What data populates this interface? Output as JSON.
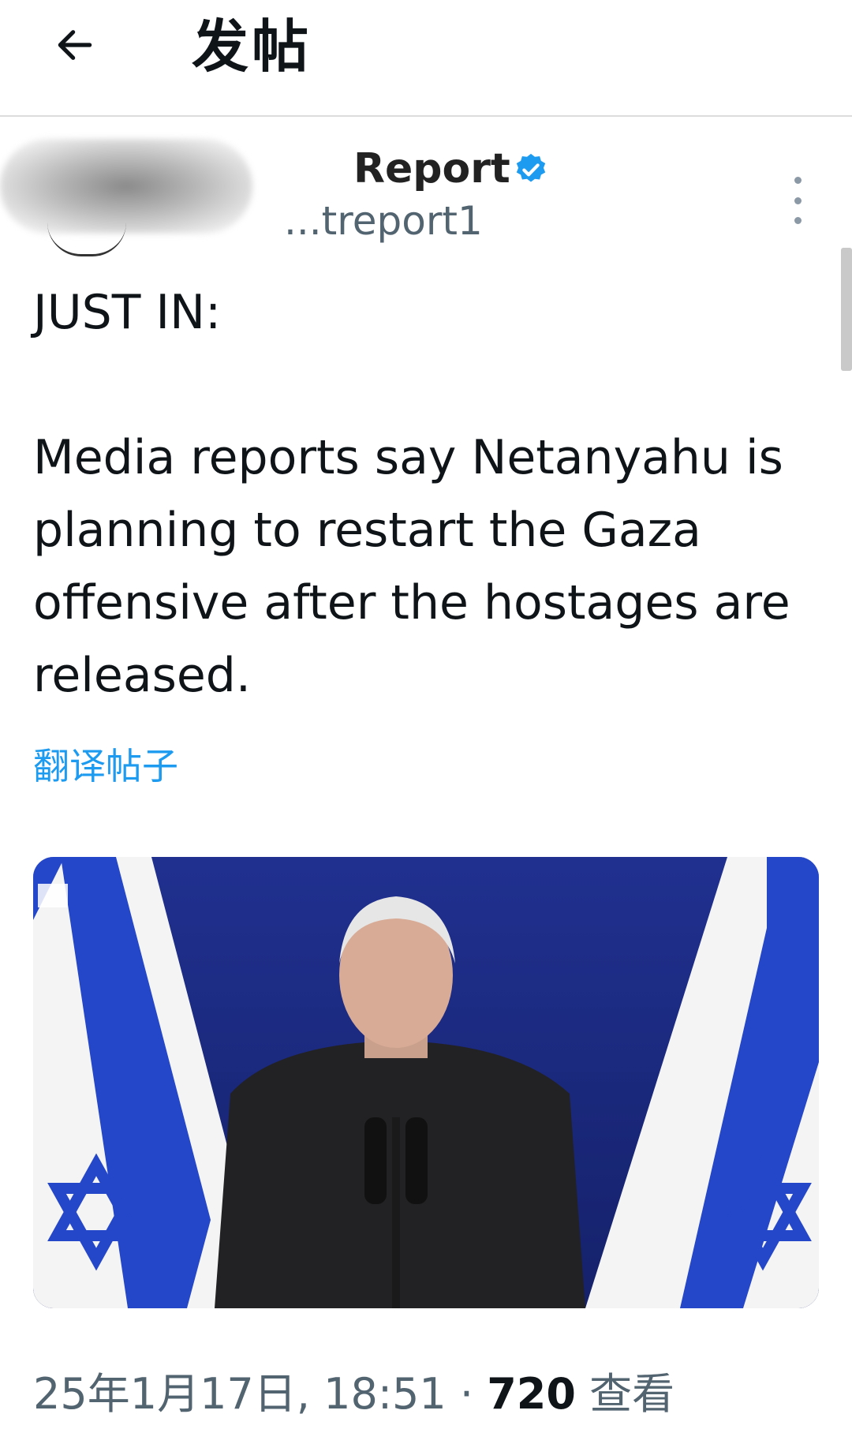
{
  "header": {
    "title": "发帖",
    "back_icon": "arrow-left-icon"
  },
  "author": {
    "display_name": "Report",
    "handle": "...treport1",
    "verified_icon": "verified-badge-icon",
    "more_icon": "more-vertical-icon"
  },
  "tweet": {
    "text": "JUST IN:\n\nMedia reports say Netanyahu is planning to restart the Gaza offensive after the hostages are released.",
    "translate_label": "翻译帖子"
  },
  "meta": {
    "timestamp": "25年1月17日, 18:51",
    "separator": " · ",
    "views": "720",
    "views_label": " 查看"
  },
  "colors": {
    "accent": "#1d9bf0",
    "flag_blue": "#1f3fc4",
    "backdrop": "#1b2a8a"
  }
}
